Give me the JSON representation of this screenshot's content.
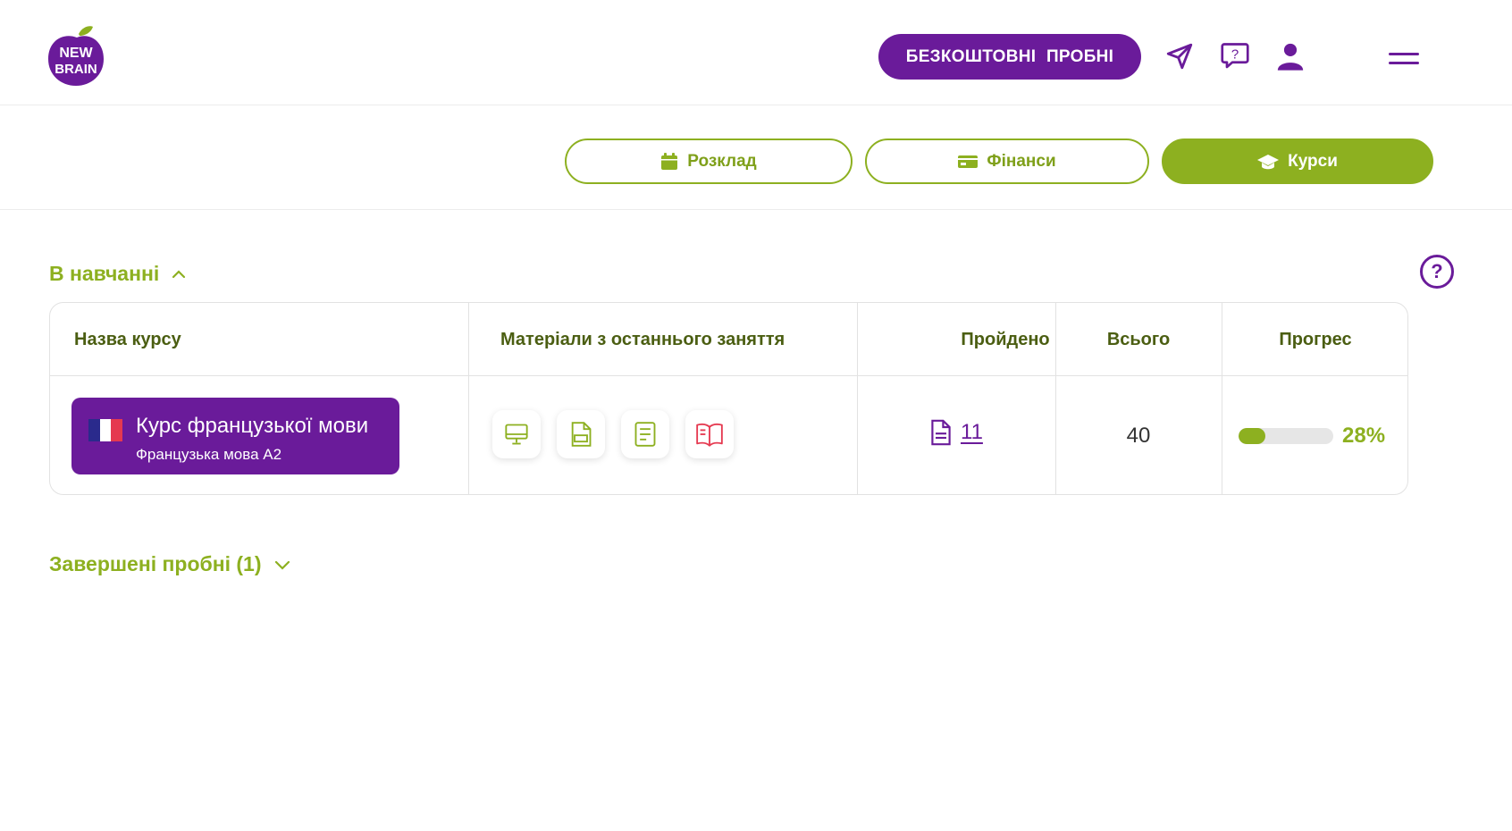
{
  "header": {
    "logo_text": "NEW BRAIN",
    "trial_button": "БЕЗКОШТОВНІ ПРОБНІ",
    "icons": [
      "send-icon",
      "chat-help-icon",
      "user-icon",
      "menu-icon"
    ]
  },
  "tabs": [
    {
      "label": "Розклад",
      "icon": "calendar-icon",
      "active": false
    },
    {
      "label": "Фінанси",
      "icon": "finance-icon",
      "active": false
    },
    {
      "label": "Курси",
      "icon": "graduation-cap-icon",
      "active": true
    }
  ],
  "in_progress": {
    "title": "В навчанні",
    "expanded": true,
    "columns": [
      "Назва курсу",
      "Матеріали з останнього заняття",
      "Пройдено",
      "Всього",
      "Прогрес"
    ],
    "rows": [
      {
        "course_title": "Курс французької мови",
        "course_subtitle": "Французька мова А2",
        "flag": "france-flag-icon",
        "materials": [
          "presentation-icon",
          "pdf-icon",
          "document-icon",
          "book-icon"
        ],
        "passed": "11",
        "total": "40",
        "progress": 28,
        "progress_label": "28%"
      }
    ]
  },
  "completed_trials": {
    "title": "Завершені пробні (1)",
    "expanded": false
  },
  "colors": {
    "purple": "#6a1b9a",
    "green": "#8db020",
    "dark_green": "#4b5e12",
    "red": "#e53950"
  }
}
